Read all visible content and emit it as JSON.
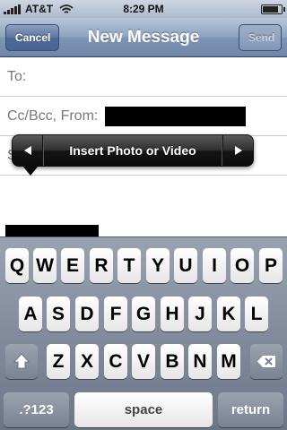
{
  "status_bar": {
    "carrier": "AT&T",
    "time": "8:29 PM",
    "signal_icon": "signal-bars-icon",
    "wifi_icon": "wifi-icon",
    "battery_icon": "battery-icon"
  },
  "nav": {
    "cancel_label": "Cancel",
    "title": "New Message",
    "send_label": "Send"
  },
  "compose": {
    "to_label": "To:",
    "cc_label": "Cc/Bcc, From:",
    "subject_label": "S"
  },
  "callout": {
    "label": "Insert Photo or Video",
    "prev_icon": "triangle-left-icon",
    "next_icon": "triangle-right-icon"
  },
  "keyboard": {
    "row1": [
      "Q",
      "W",
      "E",
      "R",
      "T",
      "Y",
      "U",
      "I",
      "O",
      "P"
    ],
    "row2": [
      "A",
      "S",
      "D",
      "F",
      "G",
      "H",
      "J",
      "K",
      "L"
    ],
    "row3": [
      "Z",
      "X",
      "C",
      "V",
      "B",
      "N",
      "M"
    ],
    "numbers_label": ".?123",
    "space_label": "space",
    "return_label": "return",
    "shift_icon": "shift-arrow-icon",
    "delete_icon": "backspace-icon"
  }
}
